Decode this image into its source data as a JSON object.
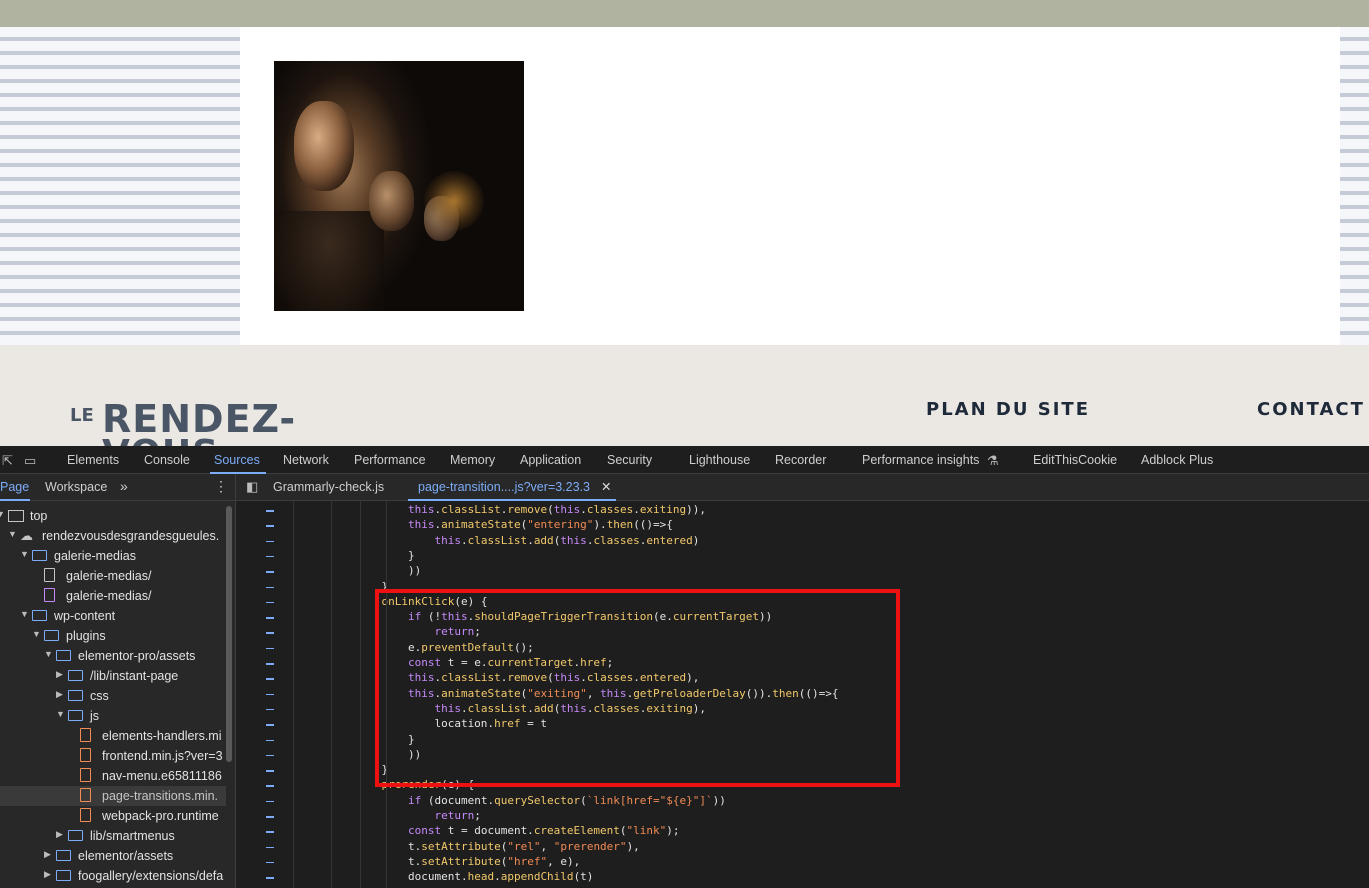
{
  "website": {
    "logo_prefix": "LE",
    "logo_main": "RENDEZ-",
    "logo_sub": "VOUS",
    "footer_links": [
      "PLAN DU SITE",
      "CONTACT"
    ],
    "photo_alt": "audience-photo"
  },
  "devtools": {
    "tabs": [
      "Elements",
      "Console",
      "Sources",
      "Network",
      "Performance",
      "Memory",
      "Application",
      "Security",
      "Lighthouse",
      "Recorder",
      "Performance insights",
      "EditThisCookie",
      "Adblock Plus"
    ],
    "active_tab": "Sources",
    "left_panel_tabs": [
      "Page",
      "Workspace"
    ],
    "tree": [
      {
        "label": "top",
        "icon": "page-icon"
      },
      {
        "label": "rendezvousdesgrandesgueules.",
        "icon": "cloud-icon"
      },
      {
        "label": "galerie-medias",
        "icon": "folder-icon"
      },
      {
        "label": "galerie-medias/",
        "icon": "file-icon"
      },
      {
        "label": "galerie-medias/",
        "icon": "file-icon-purple"
      },
      {
        "label": "wp-content",
        "icon": "folder-icon"
      },
      {
        "label": "plugins",
        "icon": "folder-icon"
      },
      {
        "label": "elementor-pro/assets",
        "icon": "folder-icon"
      },
      {
        "label": "/lib/instant-page",
        "icon": "folder-icon"
      },
      {
        "label": "css",
        "icon": "folder-icon"
      },
      {
        "label": "js",
        "icon": "folder-icon"
      },
      {
        "label": "elements-handlers.mi",
        "icon": "file-icon-orange"
      },
      {
        "label": "frontend.min.js?ver=3",
        "icon": "file-icon-orange"
      },
      {
        "label": "nav-menu.e65811186",
        "icon": "file-icon-orange"
      },
      {
        "label": "page-transitions.min.",
        "icon": "file-icon-orange"
      },
      {
        "label": "webpack-pro.runtime",
        "icon": "file-icon-orange"
      },
      {
        "label": "lib/smartmenus",
        "icon": "folder-icon"
      },
      {
        "label": "elementor/assets",
        "icon": "folder-icon"
      },
      {
        "label": "foogallery/extensions/defa",
        "icon": "folder-icon"
      }
    ],
    "editor_tabs": [
      "Grammarly-check.js",
      "page-transition....js?ver=3.23.3"
    ],
    "code_lines": [
      "                this.classList.remove(this.classes.exiting)),",
      "                this.animateState(\"entering\").then(()=>{",
      "                    this.classList.add(this.classes.entered)",
      "                }",
      "                ))",
      "            }",
      "            onLinkClick(e) {",
      "                if (!this.shouldPageTriggerTransition(e.currentTarget))",
      "                    return;",
      "                e.preventDefault();",
      "                const t = e.currentTarget.href;",
      "                this.classList.remove(this.classes.entered),",
      "                this.animateState(\"exiting\", this.getPreloaderDelay()).then(()=>{",
      "                    this.classList.add(this.classes.exiting),",
      "                    location.href = t",
      "                }",
      "                ))",
      "            }",
      "            prerender(e) {",
      "                if (document.querySelector(`link[href=\"${e}\"]`))",
      "                    return;",
      "                const t = document.createElement(\"link\");",
      "                t.setAttribute(\"rel\", \"prerender\"),",
      "                t.setAttribute(\"href\", e),",
      "                document.head.appendChild(t)"
    ]
  }
}
